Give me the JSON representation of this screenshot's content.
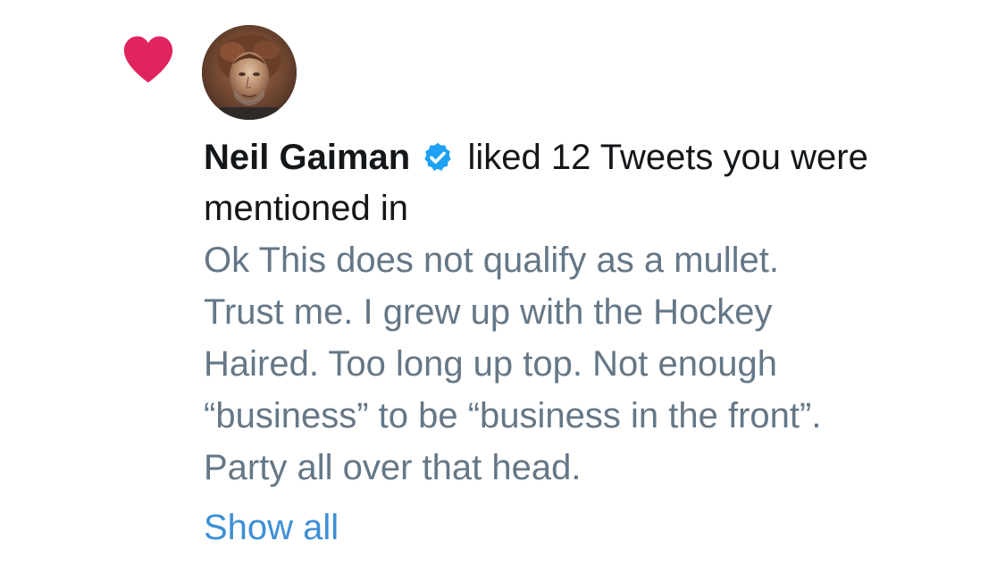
{
  "notification": {
    "icon": "heart-icon",
    "icon_color": "#e0245e",
    "avatar": "avatar-photo",
    "user_name": "Neil Gaiman",
    "verified_icon": "verified-badge-icon",
    "verified_color": "#1da1f2",
    "action_text": "liked 12 Tweets you were mentioned in",
    "tweet_text": "Ok This does not qualify as a mullet.\nTrust me. I grew up with the Hockey\nHaired.  Too long up top. Not enough\n“business” to be “business in the front”.\nParty all over that head.",
    "show_all_label": "Show all",
    "link_color": "#3d8fd6",
    "secondary_text_color": "#657786"
  }
}
